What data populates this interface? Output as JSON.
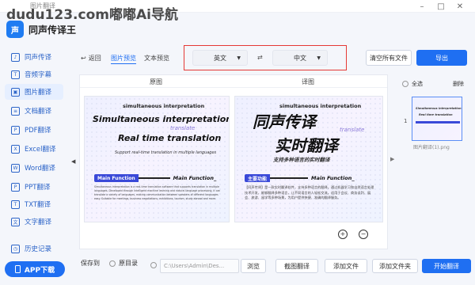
{
  "watermark": "dudu123.com嘟嘟Ai导航",
  "window": {
    "title": "图片翻译",
    "controls": [
      "–",
      "□",
      "✕"
    ]
  },
  "brand": {
    "logo_text": "声",
    "name": "同声传译王"
  },
  "sidebar": {
    "items": [
      {
        "label": "同声传译",
        "icon": "mic-icon"
      },
      {
        "label": "音频字幕",
        "icon": "subtitle-icon"
      },
      {
        "label": "图片翻译",
        "icon": "image-icon"
      },
      {
        "label": "文档翻译",
        "icon": "doc-icon"
      },
      {
        "label": "PDF翻译",
        "icon": "pdf-icon"
      },
      {
        "label": "Excel翻译",
        "icon": "excel-icon"
      },
      {
        "label": "Word翻译",
        "icon": "word-icon"
      },
      {
        "label": "PPT翻译",
        "icon": "ppt-icon"
      },
      {
        "label": "TXT翻译",
        "icon": "txt-icon"
      },
      {
        "label": "文字翻译",
        "icon": "text-icon"
      }
    ],
    "history": "历史记录",
    "app_download": "APP下载",
    "collapse_glyph": "◀"
  },
  "toolbar": {
    "back": "返回",
    "tabs": [
      "图片预览",
      "文本预览"
    ],
    "source_lang": "英文",
    "target_lang": "中文",
    "swap_glyph": "⇄",
    "clear_all": "清空所有文件",
    "export": "导出"
  },
  "panel": {
    "original_title": "原图",
    "translated_title": "译图",
    "original": {
      "line1": "simultaneous interpretation",
      "line2": "Simultaneous interpretation",
      "line3": "translate",
      "line4": "Real time translation",
      "line5": "Support real-time translation in multiple languages",
      "mf_badge": "Main Function",
      "mf_text": "Main Function_",
      "para": "Simultaneous interpretation is a real-time translation software that supports translation in multiple languages. Developed through intelligent machine learning and natural language processing, it can translate a variety of languages, making communication between speakers of different languages easy. Suitable for meetings, business negotiations, exhibitions, tourism, study abroad and more."
    },
    "translated": {
      "line1": "simultaneous interpretation",
      "line2": "同声传译",
      "line3": "translate",
      "line4": "实时翻译",
      "line5": "支持多种语言的实时翻译",
      "mf_badge": "主要功能",
      "mf_text": "Main Function_",
      "para": "【同声传译】是一款实时翻译软件，支持多种语言的翻译。通过机器学习和自然语言处理技术开发，能够翻译多种语言，让不同语言的人轻松交流。适用于会议、商务谈判、展会、旅游、留学等多种场景，为用户提供快捷、准确的翻译服务。"
    },
    "zoom_in": "+",
    "zoom_out": "−",
    "next_glyph": "▶"
  },
  "thumbs": {
    "select_all": "全选",
    "delete": "删除",
    "page_number": "1",
    "filename": "图片翻译(1).png",
    "thumb_line1": "Simultaneous interpretation",
    "thumb_line2": "Real time translation"
  },
  "footer": {
    "save_to": "保存到",
    "orig_dir": "原目录",
    "path": "C:\\Users\\Admin\\Des...",
    "browse": "浏览",
    "screenshot": "截图翻译",
    "add_file": "添加文件",
    "add_folder": "添加文件夹",
    "start": "开始翻译"
  },
  "colors": {
    "accent": "#1f6ff2",
    "highlight_border": "#e53935",
    "badge": "#3a49d8"
  }
}
